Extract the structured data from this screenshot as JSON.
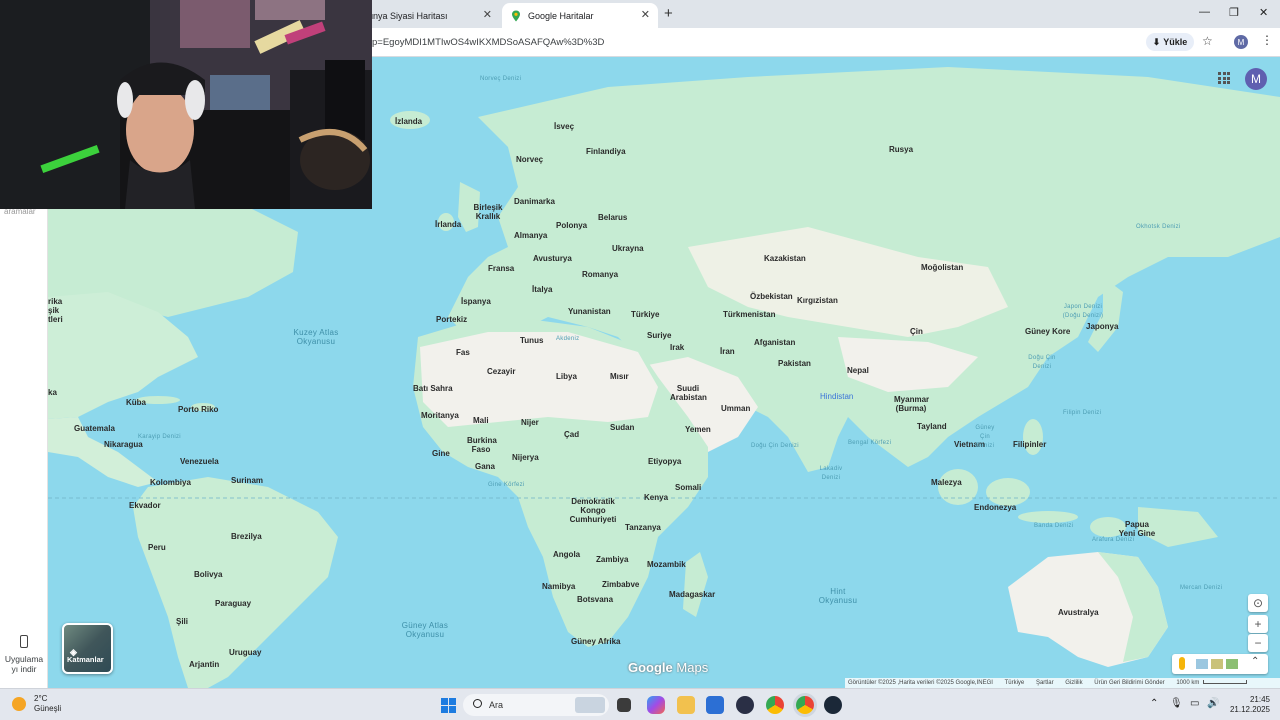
{
  "browser": {
    "tabs": [
      {
        "label": "ünya Siyasi Haritası",
        "active": false
      },
      {
        "label": "Google Haritalar",
        "active": true
      }
    ],
    "url": "p=EgoyMDI1MTIwOS4wIKXMDSoASAFQAw%3D%3D",
    "install_label": "Yükle",
    "profile_initial": "M"
  },
  "sidebar": {
    "recent_label": "aramalar",
    "app_label_line1": "Uygulama",
    "app_label_line2": "yı indir"
  },
  "map": {
    "account_initial": "M",
    "layers_label": "Katmanlar",
    "brand_google": "Google",
    "brand_maps": "Maps",
    "attribution": {
      "imagery": "Görüntüler ©2025 ,Harita verileri ©2025 Google,INEGI",
      "country": "Türkiye",
      "terms": "Şartlar",
      "privacy": "Gizlilik",
      "feedback": "Ürün Geri Bildirimi Gönder",
      "scale": "1000 km"
    },
    "countries": [
      "İzlanda",
      "İsveç",
      "Finlandiya",
      "Norveç",
      "Rusya",
      "Birleşik Krallık",
      "Danimarka",
      "İrlanda",
      "Belarus",
      "Polonya",
      "Almanya",
      "Ukrayna",
      "Avusturya",
      "Fransa",
      "Romanya",
      "Kazakistan",
      "Moğolistan",
      "İspanya",
      "İtalya",
      "Özbekistan",
      "Kırgızistan",
      "Portekiz",
      "Yunanistan",
      "Türkiye",
      "Türkmenistan",
      "Çin",
      "Güney Kore",
      "Japonya",
      "Suriye",
      "Tunus",
      "Irak",
      "Afganistan",
      "İran",
      "Fas",
      "Pakistan",
      "Nepal",
      "Cezayir",
      "Libya",
      "Mısır",
      "Batı Sahra",
      "Suudi Arabistan",
      "Hindistan",
      "Myanmar (Burma)",
      "Moritanya",
      "Mali",
      "Nijer",
      "Umman",
      "Sudan",
      "Çad",
      "Tayland",
      "Yemen",
      "Burkina Faso",
      "Vietnam",
      "Filipinler",
      "Gine",
      "Nijerya",
      "Gana",
      "Etiyopya",
      "Malezya",
      "Somali",
      "Kenya",
      "Demokratik Kongo Cumhuriyeti",
      "Endonezya",
      "Tanzanya",
      "Papua Yeni Gine",
      "Angola",
      "Zambiya",
      "Mozambik",
      "Zimbabve",
      "Namibya",
      "Madagaskar",
      "Botsvana",
      "Avustralya",
      "Güney Afrika",
      "Küba",
      "Porto Riko",
      "Guatemala",
      "Nikaragua",
      "Venezuela",
      "Surinam",
      "Kolombiya",
      "Ekvador",
      "Peru",
      "Brezilya",
      "Bolivya",
      "Paraguay",
      "Şili",
      "Uruguay",
      "Arjantin"
    ],
    "left_edge_fragments": [
      "rika",
      "şik",
      "tleri",
      "ka"
    ],
    "seas": [
      "Norveç Denizi",
      "Kuzey Atlas Okyanusu",
      "Akdeniz",
      "Arap Denizi",
      "Bengal Körfezi",
      "Hint Okyanusu",
      "Güney Atlas Okyanusu",
      "Gine Körfezi",
      "Okhotsk Denizi",
      "Japon Denizi (Doğu Denizi)",
      "Doğu Çin Denizi",
      "Filipin Denizi",
      "Güney Çin Denizi",
      "Banda Denizi",
      "Arafura Denizi",
      "Mercan Denizi",
      "Umman Denizi",
      "Yemen Denizi",
      "Karayip Denizi",
      "Lakadiv Denizi",
      "Kızıldeniz"
    ]
  },
  "taskbar": {
    "weather_temp": "2°C",
    "weather_desc": "Güneşli",
    "search_label": "Ara",
    "time": "21:45",
    "date": "21.12.2025"
  },
  "colors": {
    "ocean": "#8dd8ec",
    "land": "#c6ecd3",
    "desert": "#f2f1ec",
    "accent": "#1a73e8"
  }
}
